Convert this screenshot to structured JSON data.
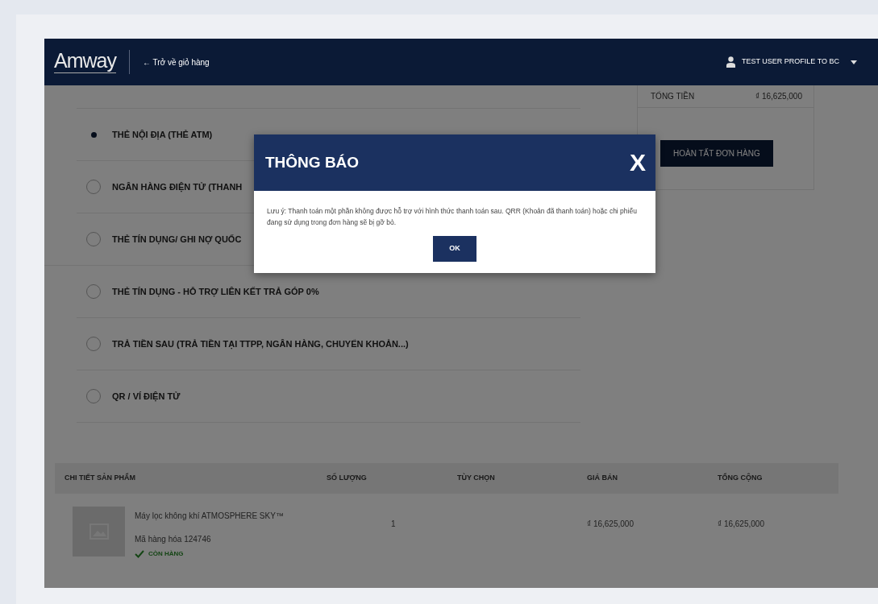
{
  "header": {
    "logo": "Amway",
    "back_link": "← Trở về giỏ hàng",
    "user": "TEST USER PROFILE TO BC"
  },
  "summary": {
    "total_label": "TỔNG TIỀN",
    "total_value": "₫ 16,625,000",
    "submit": "HOÀN TẤT ĐƠN HÀNG"
  },
  "payment_options": [
    {
      "label": "THẺ NỘI ĐỊA (THẺ ATM)",
      "selected": true
    },
    {
      "label": "NGÂN HÀNG ĐIỆN TỬ (THANH",
      "selected": false
    },
    {
      "label": "THẺ TÍN DỤNG/ GHI NỢ QUỐC",
      "selected": false
    },
    {
      "label": "THẺ TÍN DỤNG - HỖ TRỢ LIÊN KẾT TRẢ GÓP 0%",
      "selected": false
    },
    {
      "label": "TRẢ TIỀN SAU (TRẢ TIỀN TẠI TTPP, NGÂN HÀNG, CHUYỂN KHOẢN...)",
      "selected": false
    },
    {
      "label": "QR / VÍ ĐIỆN TỬ",
      "selected": false
    }
  ],
  "table": {
    "columns": [
      "CHI TIẾT SẢN PHẨM",
      "SỐ LƯỢNG",
      "TÙY CHỌN",
      "GIÁ BÁN",
      "TỔNG CỘNG"
    ],
    "rows": [
      {
        "name": "Máy lọc không khí ATMOSPHERE SKY™",
        "code": "Mã hàng hóa 124746",
        "stock": "CÒN HÀNG",
        "in_stock": true,
        "quantity": "1",
        "price": "₫ 16,625,000",
        "total": "₫ 16,625,000"
      }
    ]
  },
  "dialog": {
    "title": "THÔNG BÁO",
    "close": "X",
    "message": "Lưu ý: Thanh toán một phần không được hỗ trợ với hình thức thanh toán sau. QRR (Khoản đã thanh toán) hoặc chi phiếu đang sử dụng trong đơn hàng sẽ bị gỡ bỏ.",
    "ok": "OK"
  }
}
